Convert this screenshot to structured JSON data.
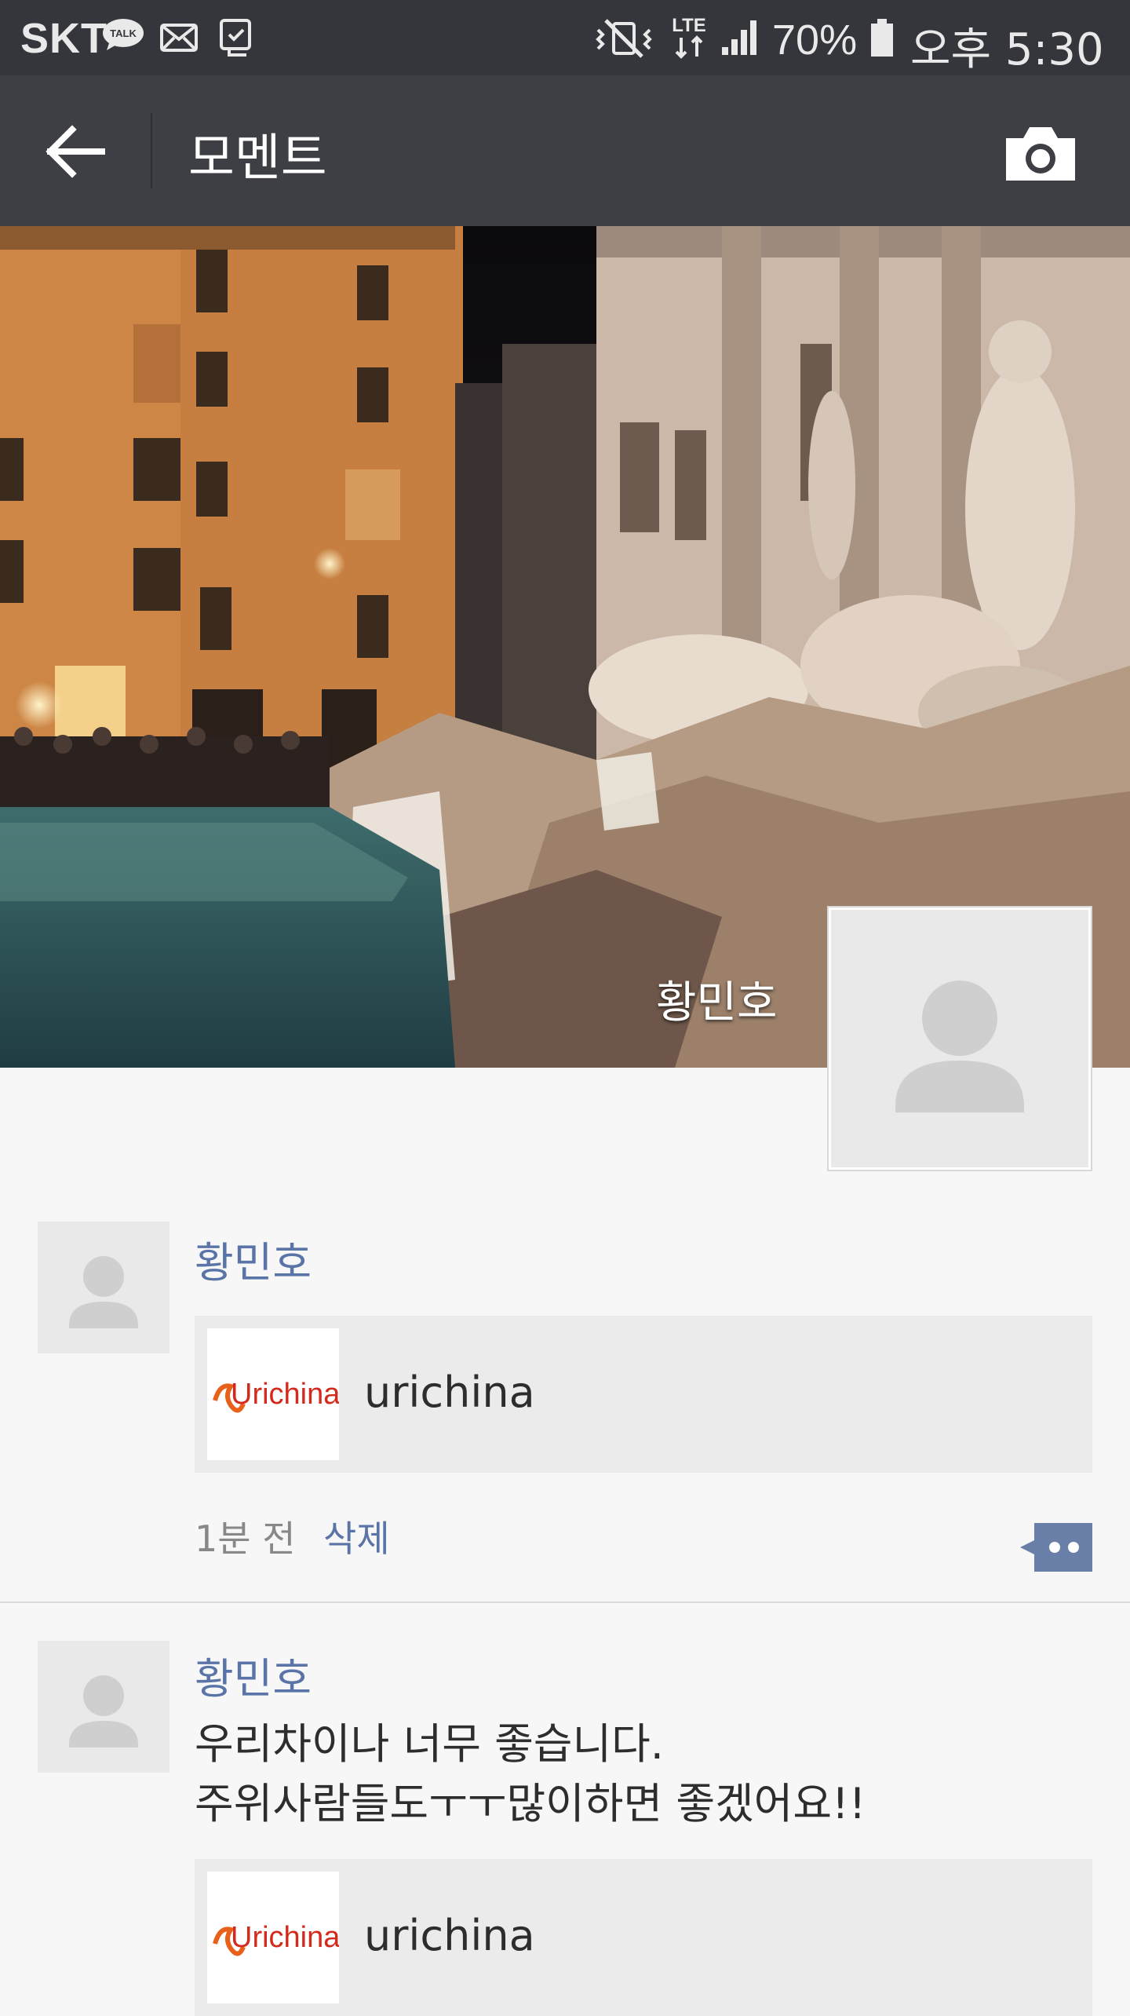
{
  "status_bar": {
    "carrier": "SKT",
    "talk_badge": "TALK",
    "lte": "LTE",
    "battery": "70%",
    "time": "오후 5:30"
  },
  "header": {
    "title": "모멘트",
    "back_icon": "arrow-left-icon",
    "camera_icon": "camera-icon"
  },
  "profile": {
    "name": "황민호"
  },
  "posts": [
    {
      "author": "황민호",
      "text_lines": [],
      "link": {
        "title": "urichina",
        "logo_text": "Urichina"
      },
      "time": "1분 전",
      "delete_label": "삭제"
    },
    {
      "author": "황민호",
      "text_lines": [
        "우리차이나 너무 좋습니다.",
        "주위사람들도ㅜㅜ많이하면 좋겠어요!!"
      ],
      "link": {
        "title": "urichina",
        "logo_text": "Urichina"
      }
    }
  ],
  "colors": {
    "status_bg": "#34363b",
    "appbar_bg": "#3d3f45",
    "link_blue": "#5a74a8",
    "logo_orange": "#e8611a",
    "logo_red": "#d42a1e"
  }
}
